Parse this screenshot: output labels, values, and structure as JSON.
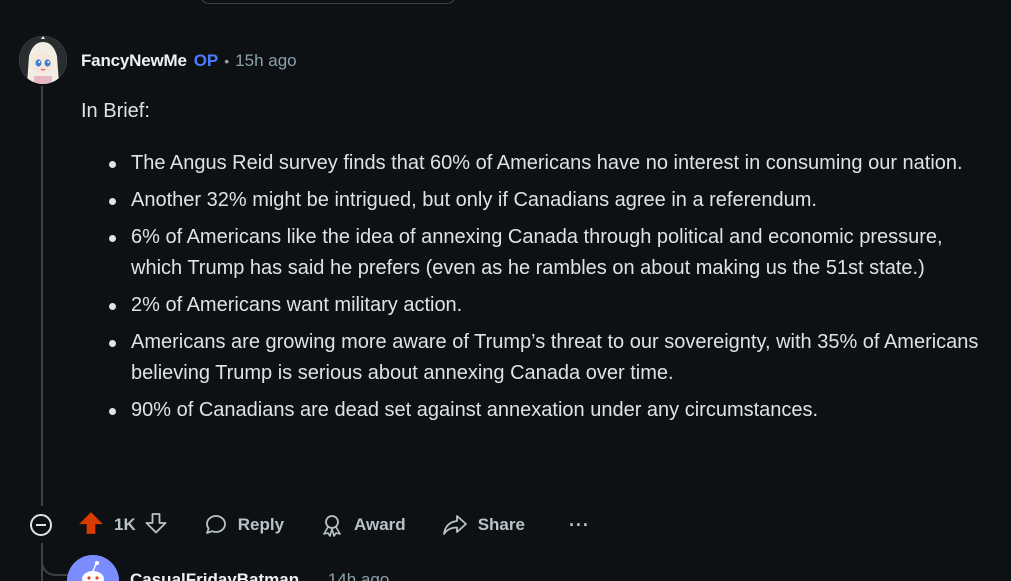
{
  "comment": {
    "author": "FancyNewMe",
    "op_badge": "OP",
    "separator": "•",
    "time": "15h ago",
    "intro": "In Brief:",
    "points": [
      "The Angus Reid survey finds that 60% of Americans have no interest in consuming our nation.",
      "Another 32% might be intrigued, but only if Canadians agree in a referendum.",
      "6% of Americans like the idea of annexing Canada through political and economic pressure, which Trump has said he prefers (even as he rambles on about making us the 51st state.)",
      "2% of Americans want military action.",
      "Americans are growing more aware of Trump’s threat to our sovereignty, with 35% of Americans believing Trump is serious about annexing Canada over time.",
      "90% of  Canadians are dead set against annexation under any circumstances."
    ]
  },
  "actions": {
    "vote_count": "1K",
    "upvote_color": "#d93a00",
    "reply_label": "Reply",
    "award_label": "Award",
    "share_label": "Share",
    "more_label": "···"
  },
  "next_comment": {
    "author": "CasualFridayBatman",
    "time": "14h ago"
  },
  "icons": {
    "collapse": "minus-circle-icon",
    "upvote": "upvote-arrow-icon",
    "downvote": "downvote-arrow-icon",
    "reply": "speech-bubble-icon",
    "award": "award-ribbon-icon",
    "share": "share-arrow-icon",
    "more": "ellipsis-icon"
  }
}
